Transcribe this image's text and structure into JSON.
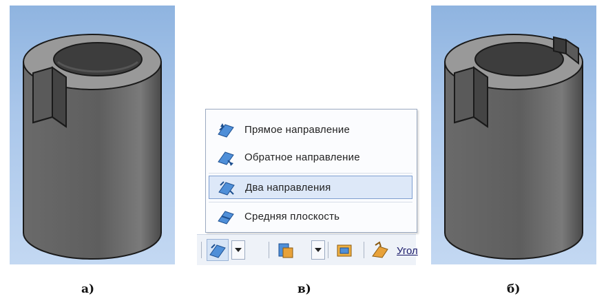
{
  "figure_captions": {
    "a": "а)",
    "v": "в)",
    "b": "б)"
  },
  "menu": {
    "items": [
      {
        "label": "Прямое направление",
        "icon": "direct-direction-icon",
        "highlighted": false
      },
      {
        "label": "Обратное направление",
        "icon": "reverse-direction-icon",
        "highlighted": false
      },
      {
        "label": "Два направления",
        "icon": "two-directions-icon",
        "highlighted": true
      },
      {
        "label": "Средняя плоскость",
        "icon": "middle-plane-icon",
        "highlighted": false
      }
    ]
  },
  "toolbar": {
    "corner_label": "Угол"
  },
  "colors": {
    "panel_bg": "#a9c6ea",
    "model_body": "#6f6f6f",
    "model_top": "#9a9a9a",
    "menu_highlight": "#dde8f8"
  }
}
